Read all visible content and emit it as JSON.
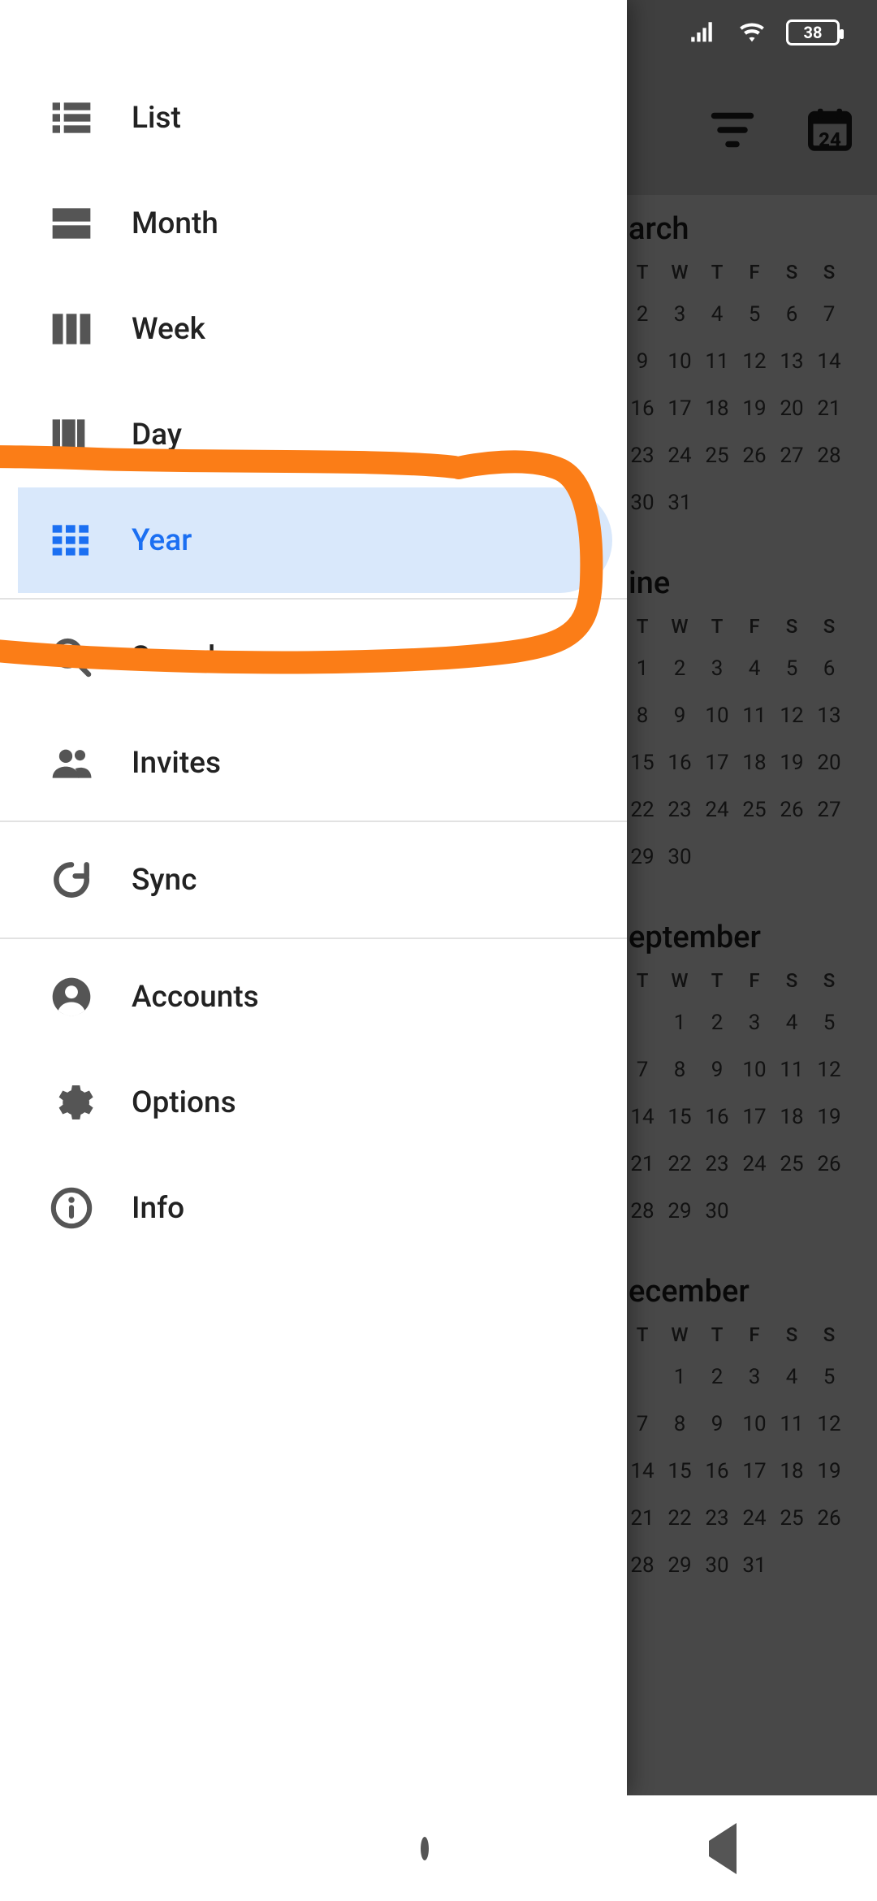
{
  "status": {
    "battery": "38"
  },
  "appbar": {
    "today_badge": "24"
  },
  "drawer": {
    "items": [
      {
        "key": "list",
        "label": "List"
      },
      {
        "key": "month",
        "label": "Month"
      },
      {
        "key": "week",
        "label": "Week"
      },
      {
        "key": "day",
        "label": "Day"
      },
      {
        "key": "year",
        "label": "Year",
        "selected": true
      },
      {
        "key": "search",
        "label": "Search"
      },
      {
        "key": "invites",
        "label": "Invites"
      },
      {
        "key": "sync",
        "label": "Sync"
      },
      {
        "key": "accounts",
        "label": "Accounts"
      },
      {
        "key": "options",
        "label": "Options"
      },
      {
        "key": "info",
        "label": "Info"
      }
    ]
  },
  "months": [
    {
      "title": "arch",
      "dow": [
        "T",
        "W",
        "T",
        "F",
        "S",
        "S"
      ],
      "rows": [
        [
          "2",
          "3",
          "4",
          "5",
          "6",
          "7"
        ],
        [
          "9",
          "10",
          "11",
          "12",
          "13",
          "14"
        ],
        [
          "16",
          "17",
          "18",
          "19",
          "20",
          "21"
        ],
        [
          "23",
          "24",
          "25",
          "26",
          "27",
          "28"
        ],
        [
          "30",
          "31",
          "",
          "",
          "",
          ""
        ]
      ]
    },
    {
      "title": "ine",
      "dow": [
        "T",
        "W",
        "T",
        "F",
        "S",
        "S"
      ],
      "rows": [
        [
          "1",
          "2",
          "3",
          "4",
          "5",
          "6"
        ],
        [
          "8",
          "9",
          "10",
          "11",
          "12",
          "13"
        ],
        [
          "15",
          "16",
          "17",
          "18",
          "19",
          "20"
        ],
        [
          "22",
          "23",
          "24",
          "25",
          "26",
          "27"
        ],
        [
          "29",
          "30",
          "",
          "",
          "",
          ""
        ]
      ]
    },
    {
      "title": "eptember",
      "dow": [
        "T",
        "W",
        "T",
        "F",
        "S",
        "S"
      ],
      "rows": [
        [
          "",
          "1",
          "2",
          "3",
          "4",
          "5"
        ],
        [
          "7",
          "8",
          "9",
          "10",
          "11",
          "12"
        ],
        [
          "14",
          "15",
          "16",
          "17",
          "18",
          "19"
        ],
        [
          "21",
          "22",
          "23",
          "24",
          "25",
          "26"
        ],
        [
          "28",
          "29",
          "30",
          "",
          "",
          ""
        ]
      ]
    },
    {
      "title": "ecember",
      "dow": [
        "T",
        "W",
        "T",
        "F",
        "S",
        "S"
      ],
      "rows": [
        [
          "",
          "1",
          "2",
          "3",
          "4",
          "5"
        ],
        [
          "7",
          "8",
          "9",
          "10",
          "11",
          "12"
        ],
        [
          "14",
          "15",
          "16",
          "17",
          "18",
          "19"
        ],
        [
          "21",
          "22",
          "23",
          "24",
          "25",
          "26"
        ],
        [
          "28",
          "29",
          "30",
          "31",
          "",
          ""
        ]
      ]
    }
  ]
}
